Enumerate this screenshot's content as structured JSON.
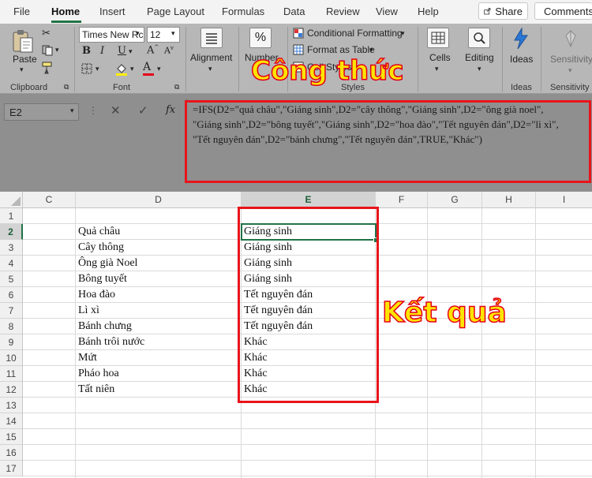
{
  "ribbon": {
    "tabs": [
      "File",
      "Home",
      "Insert",
      "Page Layout",
      "Formulas",
      "Data",
      "Review",
      "View",
      "Help"
    ],
    "active_tab": "Home",
    "share_label": "Share",
    "comments_label": "Comments",
    "clipboard": {
      "paste_label": "Paste",
      "group_label": "Clipboard"
    },
    "font": {
      "name": "Times New Rc",
      "size": "12",
      "group_label": "Font"
    },
    "alignment": {
      "label": "Alignment"
    },
    "number": {
      "label": "Number"
    },
    "styles": {
      "conditional_formatting": "Conditional Formatting",
      "format_as_table": "Format as Table",
      "cell_styles": "Cell Styles",
      "group_label": "Styles"
    },
    "cells": {
      "label": "Cells"
    },
    "editing": {
      "label": "Editing"
    },
    "ideas": {
      "label": "Ideas",
      "group_label": "Ideas"
    },
    "sensitivity": {
      "label": "Sensitivity",
      "group_label": "Sensitivity"
    }
  },
  "formula_bar": {
    "name_box": "E2",
    "fx": "fx",
    "formula_lines": [
      "=IFS(D2=\"quả châu\",\"Giáng sinh\",D2=\"cây thông\",\"Giáng sinh\",D2=\"ông già noel\",",
      "\"Giáng sinh\",D2=\"bông tuyết\",\"Giáng sinh\",D2=\"hoa đào\",\"Tết nguyên đán\",D2=\"lì xì\",",
      "\"Tết nguyên đán\",D2=\"bánh chưng\",\"Tết nguyên đán\",TRUE,\"Khác\")"
    ]
  },
  "annotations": {
    "formula": "Công thức",
    "result": "Kết quả"
  },
  "grid": {
    "columns": [
      "C",
      "D",
      "E",
      "F",
      "G",
      "H",
      "I"
    ],
    "selected_column": "E",
    "rows": [
      "1",
      "2",
      "3",
      "4",
      "5",
      "6",
      "7",
      "8",
      "9",
      "10",
      "11",
      "12",
      "13",
      "14",
      "15",
      "16",
      "17"
    ],
    "selected_row": "2",
    "column_d": [
      "",
      "Quả châu",
      "Cây thông",
      "Ông già Noel",
      "Bông tuyết",
      "Hoa đào",
      "Lì xì",
      "Bánh chưng",
      "Bánh trôi nước",
      "Mứt",
      "Pháo hoa",
      "Tất niên"
    ],
    "column_e": [
      "",
      "Giáng sinh",
      "Giáng sinh",
      "Giáng sinh",
      "Giáng sinh",
      "Tết nguyên đán",
      "Tết nguyên đán",
      "Tết nguyên đán",
      "Khác",
      "Khác",
      "Khác",
      "Khác"
    ]
  },
  "colors": {
    "accent": "#217346",
    "highlight_red": "#e8141b",
    "annotation_yellow": "#ffe400"
  }
}
